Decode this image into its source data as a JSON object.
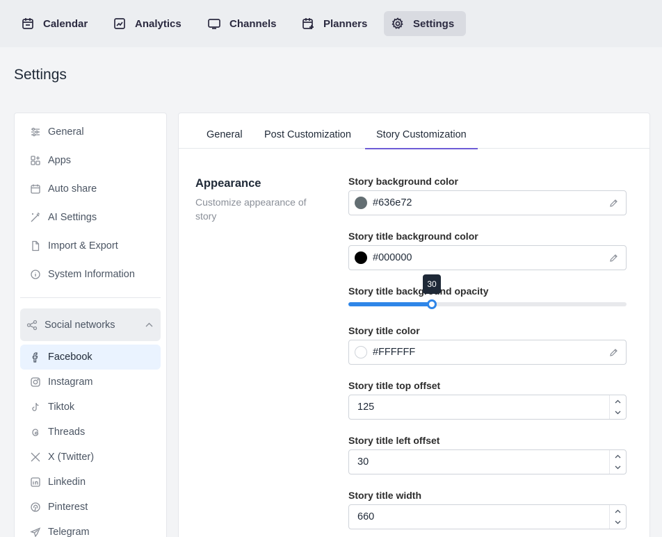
{
  "nav": {
    "items": [
      {
        "label": "Calendar",
        "icon": "calendar-icon"
      },
      {
        "label": "Analytics",
        "icon": "chart-icon"
      },
      {
        "label": "Channels",
        "icon": "monitor-icon"
      },
      {
        "label": "Planners",
        "icon": "calendar-plus-icon"
      },
      {
        "label": "Settings",
        "icon": "gear-icon"
      }
    ],
    "active": "Settings"
  },
  "page": {
    "title": "Settings"
  },
  "sidebar": {
    "items": [
      {
        "label": "General",
        "icon": "sliders-icon"
      },
      {
        "label": "Apps",
        "icon": "apps-icon"
      },
      {
        "label": "Auto share",
        "icon": "calendar-icon"
      },
      {
        "label": "AI Settings",
        "icon": "magic-wand-icon"
      },
      {
        "label": "Import & Export",
        "icon": "file-icon"
      },
      {
        "label": "System Information",
        "icon": "info-icon"
      }
    ],
    "social_group": {
      "label": "Social networks",
      "icon": "share-icon",
      "expanded": true
    },
    "networks": [
      {
        "label": "Facebook",
        "icon": "facebook-icon",
        "active": true
      },
      {
        "label": "Instagram",
        "icon": "instagram-icon"
      },
      {
        "label": "Tiktok",
        "icon": "tiktok-icon"
      },
      {
        "label": "Threads",
        "icon": "threads-icon"
      },
      {
        "label": "X (Twitter)",
        "icon": "x-icon"
      },
      {
        "label": "Linkedin",
        "icon": "linkedin-icon"
      },
      {
        "label": "Pinterest",
        "icon": "pinterest-icon"
      },
      {
        "label": "Telegram",
        "icon": "telegram-icon"
      }
    ]
  },
  "tabs": [
    {
      "label": "General"
    },
    {
      "label": "Post Customization"
    },
    {
      "label": "Story Customization",
      "active": true
    }
  ],
  "section": {
    "title": "Appearance",
    "description": "Customize appearance of story"
  },
  "fields": {
    "bg_color": {
      "label": "Story background color",
      "value": "#636e72",
      "swatch": "#636e72"
    },
    "title_bg_color": {
      "label": "Story title background color",
      "value": "#000000",
      "swatch": "#000000"
    },
    "title_bg_opacity": {
      "label": "Story title background opacity",
      "value": "30",
      "min": 0,
      "max": 100
    },
    "title_color": {
      "label": "Story title color",
      "value": "#FFFFFF",
      "swatch": "#FFFFFF"
    },
    "title_top_offset": {
      "label": "Story title top offset",
      "value": "125"
    },
    "title_left_offset": {
      "label": "Story title left offset",
      "value": "30"
    },
    "title_width": {
      "label": "Story title width",
      "value": "660"
    }
  },
  "colors": {
    "accent": "#6d5cd6",
    "slider": "#2f86e8",
    "active_item_bg": "#eaf3ff"
  }
}
